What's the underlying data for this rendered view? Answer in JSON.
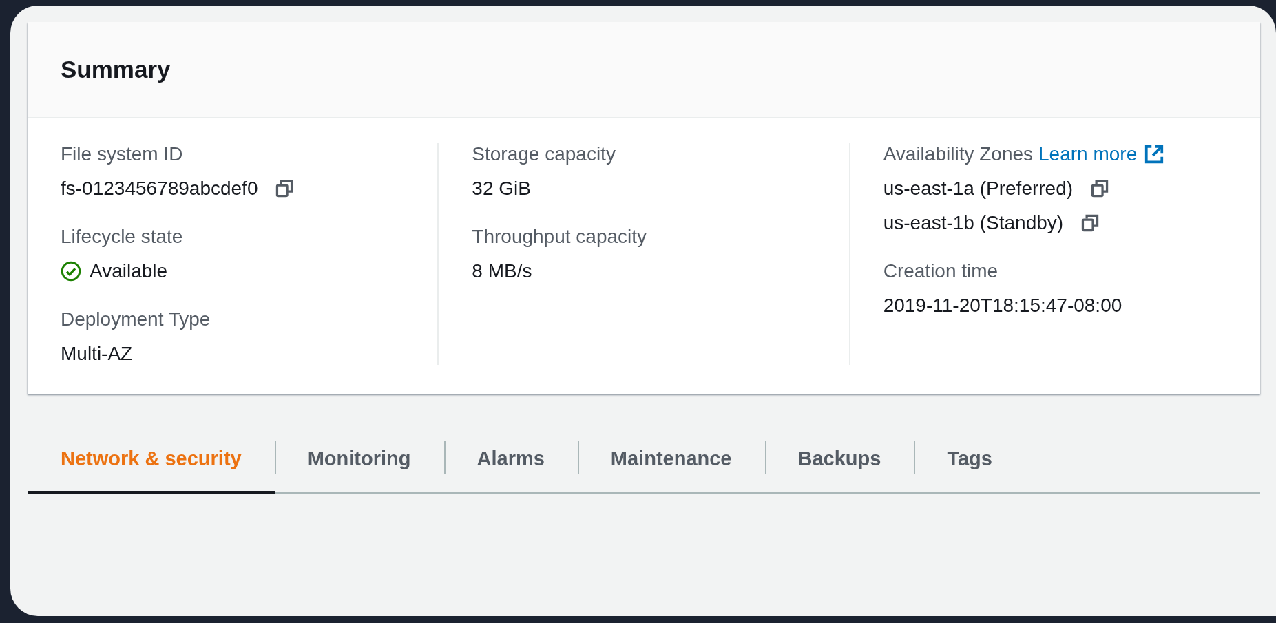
{
  "summary": {
    "title": "Summary",
    "columns": [
      [
        {
          "label": "File system ID",
          "values": [
            {
              "text": "fs-0123456789abcdef0",
              "kind": "copy"
            }
          ]
        },
        {
          "label": "Lifecycle state",
          "values": [
            {
              "text": "Available",
              "kind": "success"
            }
          ]
        },
        {
          "label": "Deployment Type",
          "values": [
            {
              "text": "Multi-AZ",
              "kind": "plain"
            }
          ]
        }
      ],
      [
        {
          "label": "Storage capacity",
          "values": [
            {
              "text": "32 GiB",
              "kind": "plain"
            }
          ]
        },
        {
          "label": "Throughput capacity",
          "values": [
            {
              "text": "8 MB/s",
              "kind": "plain"
            }
          ]
        }
      ],
      [
        {
          "label": "Availability Zones",
          "link": "Learn more",
          "values": [
            {
              "text": "us-east-1a (Preferred)",
              "kind": "copy"
            },
            {
              "text": "us-east-1b (Standby)",
              "kind": "copy"
            }
          ]
        },
        {
          "label": "Creation time",
          "values": [
            {
              "text": "2019-11-20T18:15:47-08:00",
              "kind": "plain"
            }
          ]
        }
      ]
    ]
  },
  "tabs": [
    {
      "label": "Network & security",
      "selected": true
    },
    {
      "label": "Monitoring",
      "selected": false
    },
    {
      "label": "Alarms",
      "selected": false
    },
    {
      "label": "Maintenance",
      "selected": false
    },
    {
      "label": "Backups",
      "selected": false
    },
    {
      "label": "Tags",
      "selected": false
    }
  ]
}
